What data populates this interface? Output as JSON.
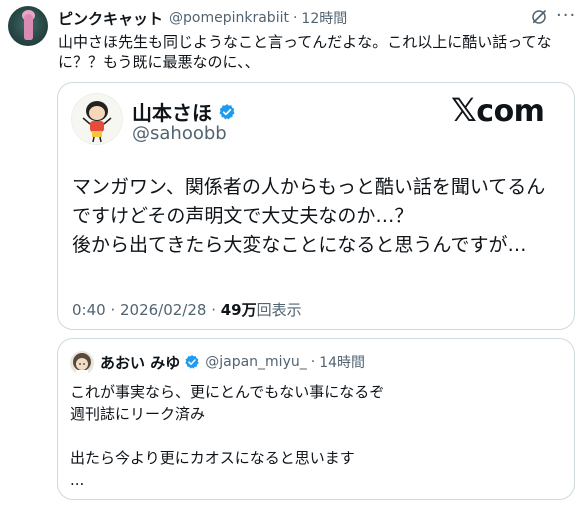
{
  "tweet": {
    "display_name": "ピンクキャット",
    "handle": "@pomepinkrabiit",
    "separator": "·",
    "time": "12時間",
    "lines": [
      "山中さほ先生も同じようなこと言ってんだよな。これ以上に酷い話ってな",
      "に？？もう既に最悪なのに、、"
    ]
  },
  "card": {
    "name": "山本さほ",
    "handle": "@sahoobb",
    "site": "com",
    "site_x": "𝕏",
    "lines": [
      "マンガワン、関係者の人からもっと酷い話を聞いてるん",
      "ですけどその声明文で大丈夫なのか…？",
      "後から出てきたら大変なことになると思うんですが…"
    ],
    "meta_time": "0:40 · 2026/02/28 · ",
    "meta_views": "49万",
    "meta_views_label": "回表示"
  },
  "quote": {
    "name": "あおい みゆ",
    "handle": "@japan_miyu_",
    "separator": "·",
    "time": "14時間",
    "lines": [
      "これが事実なら、更にとんでもない事になるぞ",
      "週刊誌にリーク済み",
      "",
      "出たら今より更にカオスになると思います",
      "..."
    ]
  },
  "colors": {
    "verified": "#1d9bf0",
    "muted": "#536471",
    "border": "#cfd9de"
  }
}
